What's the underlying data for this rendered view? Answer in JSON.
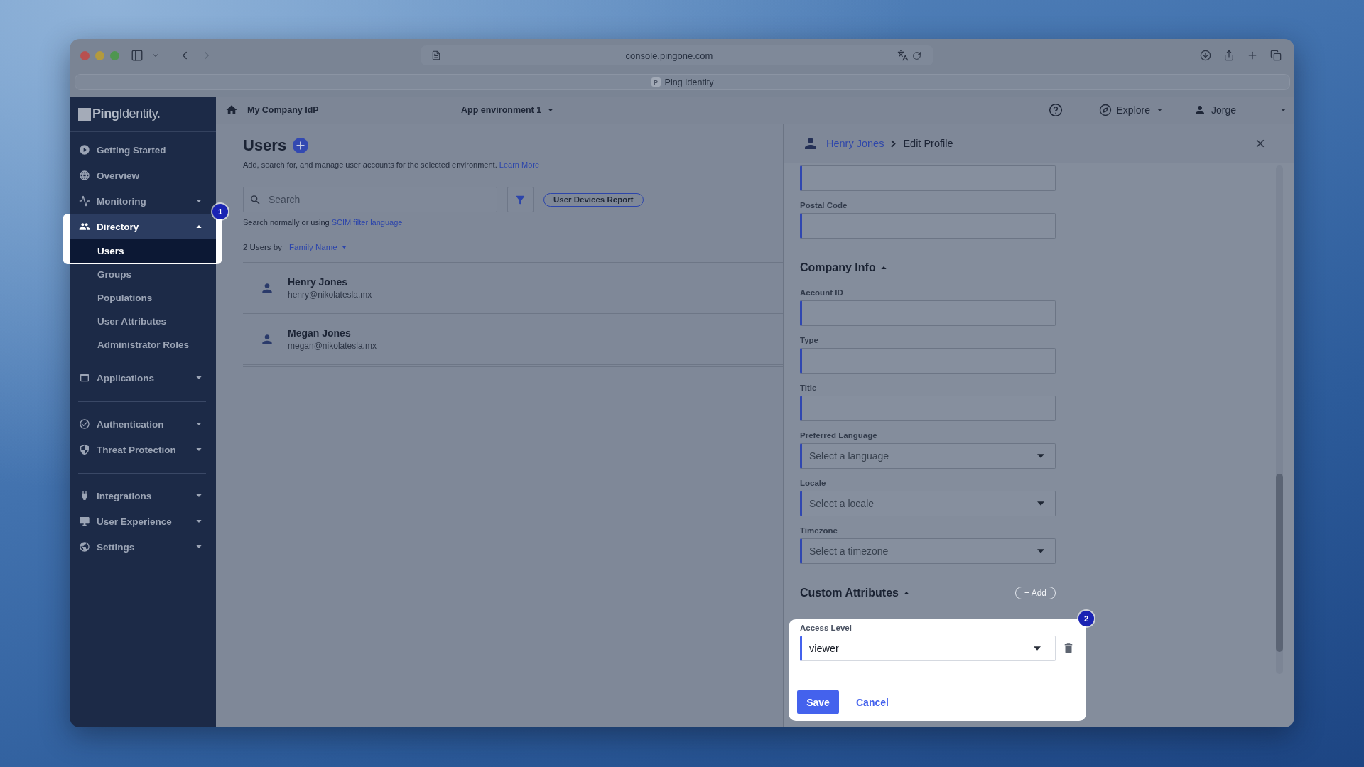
{
  "browser": {
    "url": "console.pingone.com",
    "tab": {
      "favicon": "P",
      "title": "Ping Identity"
    }
  },
  "sidebar": {
    "logo": "**Ping**Identity.",
    "sections": [
      {
        "items": [
          {
            "label": "Getting Started"
          },
          {
            "label": "Overview"
          },
          {
            "label": "Monitoring",
            "expanded": false
          },
          {
            "label": "Directory",
            "expanded": true,
            "callout": "1",
            "children": [
              {
                "label": "Users",
                "selected": true
              },
              {
                "label": "Groups",
                "selected": false
              },
              {
                "label": "Populations",
                "selected": false
              },
              {
                "label": "User Attributes",
                "selected": false
              },
              {
                "label": "Administrator Roles",
                "selected": false
              }
            ]
          },
          {
            "label": "Applications",
            "expanded": false
          }
        ]
      },
      {
        "items": [
          {
            "label": "Authentication",
            "expanded": false
          },
          {
            "label": "Threat Protection",
            "expanded": false
          }
        ]
      },
      {
        "items": [
          {
            "label": "Integrations",
            "expanded": false
          },
          {
            "label": "User Experience",
            "expanded": false
          },
          {
            "label": "Settings",
            "expanded": false
          }
        ]
      }
    ]
  },
  "topbar": {
    "organization": "My Company IdP",
    "environment": "App environment 1",
    "explore": "Explore",
    "user": "Jorge"
  },
  "users_page": {
    "title": "Users",
    "description": "Add, search for, and manage user accounts for the selected environment.",
    "learn_more": "Learn More",
    "search": {
      "placeholder": "Search"
    },
    "report_button": "User Devices Report",
    "search_hint": "Search normally or using",
    "scim_link": "SCIM filter language",
    "count": "2 Users by",
    "sort": "Family Name",
    "users": [
      {
        "name": "Henry Jones",
        "email": "henry@nikolatesla.mx"
      },
      {
        "name": "Megan Jones",
        "email": "megan@nikolatesla.mx"
      }
    ]
  },
  "edit_panel": {
    "breadcrumb": {
      "user": "Henry Jones",
      "page": "Edit Profile"
    },
    "sections": [
      {
        "fields": [
          {
            "kind": "text"
          },
          {
            "kind": "text",
            "label": "Postal Code"
          }
        ]
      },
      {
        "title": "Company Info",
        "expanded": true,
        "fields": [
          {
            "kind": "text",
            "label": "Account ID"
          },
          {
            "kind": "text",
            "label": "Type"
          },
          {
            "kind": "text",
            "label": "Title"
          },
          {
            "kind": "select",
            "label": "Preferred Language",
            "placeholder": "Select a language"
          },
          {
            "kind": "select",
            "label": "Locale",
            "placeholder": "Select a locale"
          },
          {
            "kind": "select",
            "label": "Timezone",
            "placeholder": "Select a timezone"
          }
        ]
      },
      {
        "title": "Custom Attributes",
        "expanded": true,
        "add_button": "+ Add",
        "callout": "2",
        "fields": [
          {
            "kind": "select",
            "label": "Access Level",
            "value": "viewer",
            "removable": true
          }
        ]
      }
    ],
    "actions": {
      "save": "Save",
      "cancel": "Cancel"
    }
  }
}
